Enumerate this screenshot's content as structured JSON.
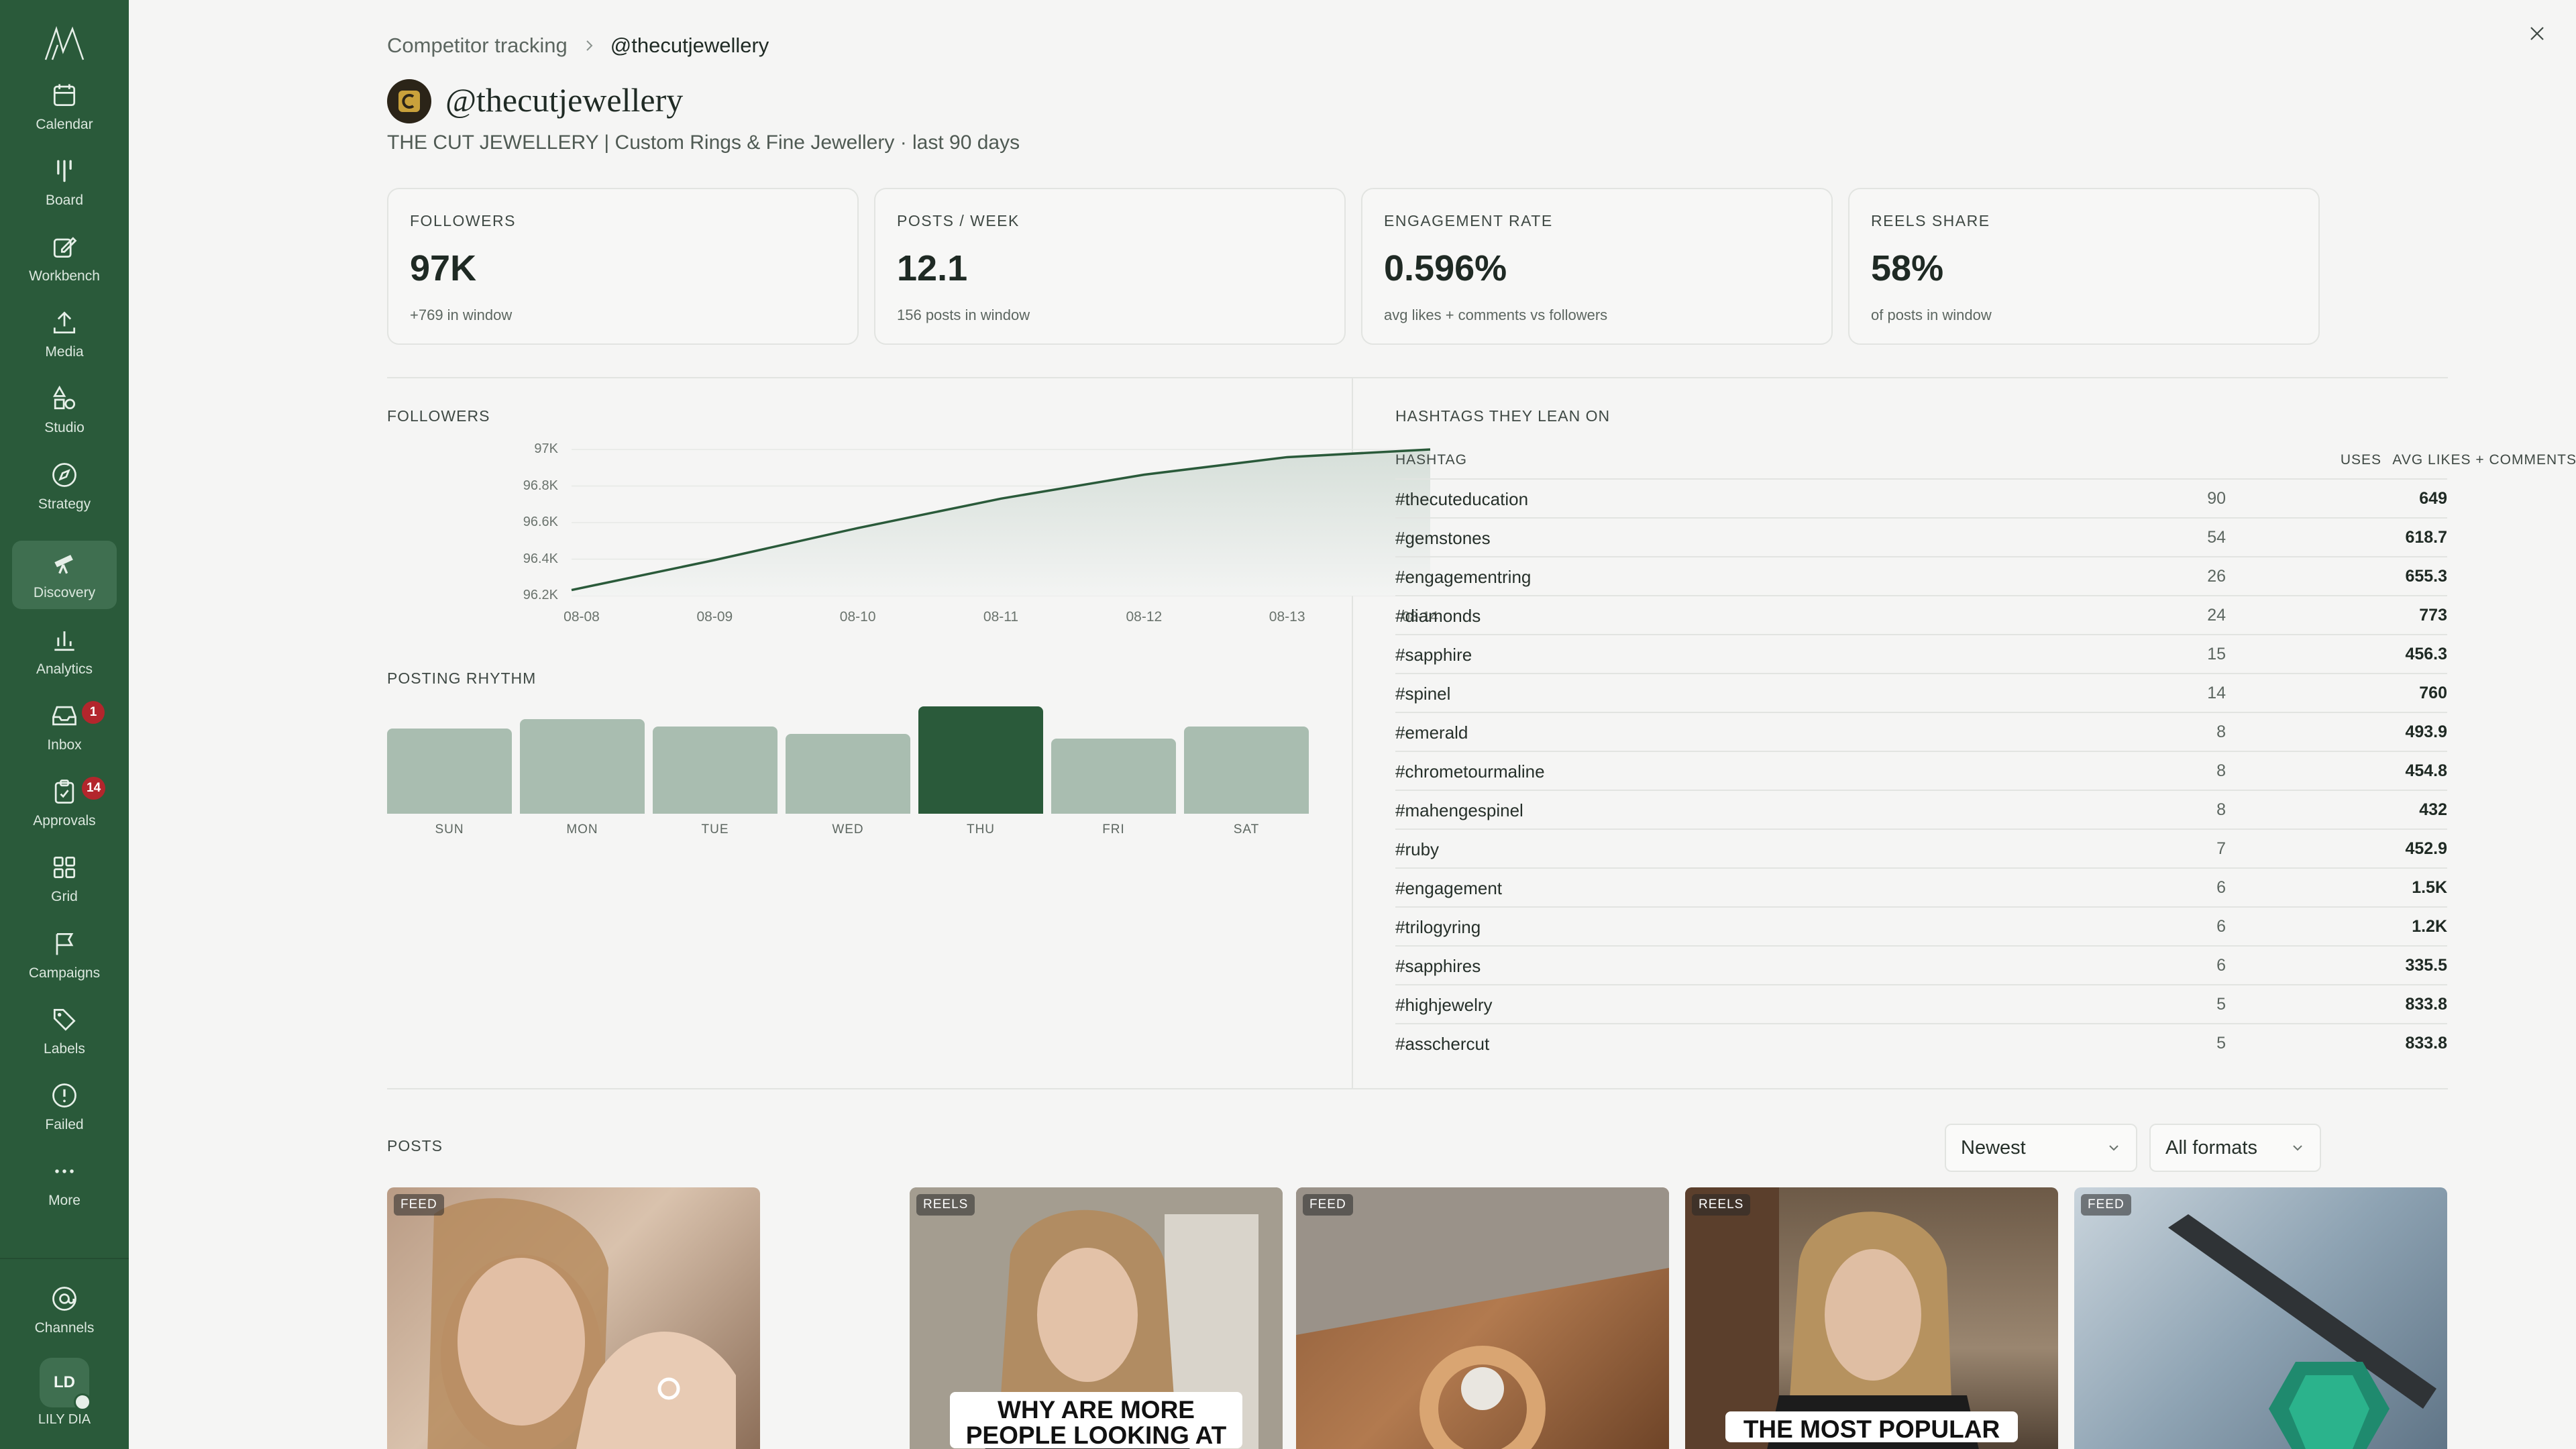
{
  "sidebar": {
    "items": [
      {
        "label": "Calendar",
        "icon": "calendar-icon"
      },
      {
        "label": "Board",
        "icon": "board-icon"
      },
      {
        "label": "Workbench",
        "icon": "workbench-icon"
      },
      {
        "label": "Media",
        "icon": "upload-icon"
      },
      {
        "label": "Studio",
        "icon": "shapes-icon"
      },
      {
        "label": "Strategy",
        "icon": "compass-icon"
      },
      {
        "label": "Discovery",
        "icon": "telescope-icon",
        "active": true
      },
      {
        "label": "Analytics",
        "icon": "bar-chart-icon"
      },
      {
        "label": "Inbox",
        "icon": "inbox-icon",
        "badge": "1"
      },
      {
        "label": "Approvals",
        "icon": "clipboard-check-icon",
        "badge": "14"
      },
      {
        "label": "Grid",
        "icon": "grid-icon"
      },
      {
        "label": "Campaigns",
        "icon": "flag-icon"
      },
      {
        "label": "Labels",
        "icon": "tag-icon"
      },
      {
        "label": "Failed",
        "icon": "alert-circle-icon"
      },
      {
        "label": "More",
        "icon": "more-dots-icon"
      }
    ],
    "channels_label": "Channels",
    "user_initials": "LD",
    "user_name": "LILY DIA"
  },
  "breadcrumb": {
    "parent": "Competitor tracking",
    "current": "@thecutjewellery"
  },
  "profile": {
    "handle": "@thecutjewellery",
    "subtitle": "THE CUT JEWELLERY | Custom Rings & Fine Jewellery · last 90 days"
  },
  "stats": [
    {
      "label": "FOLLOWERS",
      "value": "97K",
      "sub": "+769 in window"
    },
    {
      "label": "POSTS / WEEK",
      "value": "12.1",
      "sub": "156 posts in window"
    },
    {
      "label": "ENGAGEMENT RATE",
      "value": "0.596%",
      "sub": "avg likes + comments vs followers"
    },
    {
      "label": "REELS SHARE",
      "value": "58%",
      "sub": "of posts in window"
    }
  ],
  "followers_section_label": "FOLLOWERS",
  "rhythm_section_label": "POSTING RHYTHM",
  "chart_data": [
    {
      "type": "area",
      "title": "FOLLOWERS",
      "x": [
        "08-08",
        "08-09",
        "08-10",
        "08-11",
        "08-12",
        "08-13",
        "08-14"
      ],
      "series": [
        {
          "values": [
            96231,
            96395,
            96570,
            96731,
            96862,
            96958,
            97000
          ]
        }
      ],
      "y_ticks": [
        "97K",
        "96.8K",
        "96.6K",
        "96.4K",
        "96.2K"
      ],
      "y_tick_values": [
        97000,
        96800,
        96600,
        96400,
        96200
      ],
      "ylim": [
        96200,
        97000
      ],
      "color": "#2a5a3a"
    },
    {
      "type": "bar",
      "title": "POSTING RHYTHM",
      "categories": [
        "SUN",
        "MON",
        "TUE",
        "WED",
        "THU",
        "FRI",
        "SAT"
      ],
      "values": [
        17,
        19,
        17.5,
        16,
        21.5,
        15,
        17.5
      ],
      "highlight": "THU",
      "colors": {
        "default": "#a9bdb0",
        "highlight": "#2a5a3a"
      }
    }
  ],
  "hashtags": {
    "section_label": "HASHTAGS THEY LEAN ON",
    "columns": {
      "name": "HASHTAG",
      "uses": "USES",
      "avg": "AVG LIKES + COMMENTS"
    },
    "rows": [
      {
        "name": "#thecuteducation",
        "uses": "90",
        "avg": "649"
      },
      {
        "name": "#gemstones",
        "uses": "54",
        "avg": "618.7"
      },
      {
        "name": "#engagementring",
        "uses": "26",
        "avg": "655.3"
      },
      {
        "name": "#diamonds",
        "uses": "24",
        "avg": "773"
      },
      {
        "name": "#sapphire",
        "uses": "15",
        "avg": "456.3"
      },
      {
        "name": "#spinel",
        "uses": "14",
        "avg": "760"
      },
      {
        "name": "#emerald",
        "uses": "8",
        "avg": "493.9"
      },
      {
        "name": "#chrometourmaline",
        "uses": "8",
        "avg": "454.8"
      },
      {
        "name": "#mahengespinel",
        "uses": "8",
        "avg": "432"
      },
      {
        "name": "#ruby",
        "uses": "7",
        "avg": "452.9"
      },
      {
        "name": "#engagement",
        "uses": "6",
        "avg": "1.5K"
      },
      {
        "name": "#trilogyring",
        "uses": "6",
        "avg": "1.2K"
      },
      {
        "name": "#sapphires",
        "uses": "6",
        "avg": "335.5"
      },
      {
        "name": "#highjewelry",
        "uses": "5",
        "avg": "833.8"
      },
      {
        "name": "#asschercut",
        "uses": "5",
        "avg": "833.8"
      }
    ]
  },
  "posts": {
    "section_label": "POSTS",
    "sort_value": "Newest",
    "format_value": "All formats",
    "items": [
      {
        "tag": "FEED",
        "caption": ""
      },
      {
        "tag": "REELS",
        "caption": "WHY ARE MORE PEOPLE LOOKING AT"
      },
      {
        "tag": "FEED",
        "caption": ""
      },
      {
        "tag": "REELS",
        "caption": "THE MOST POPULAR"
      },
      {
        "tag": "FEED",
        "caption": ""
      }
    ]
  },
  "colors": {
    "accent": "#2a5a3a",
    "sidebar": "#2a5a3a",
    "badge": "#b3262c"
  }
}
